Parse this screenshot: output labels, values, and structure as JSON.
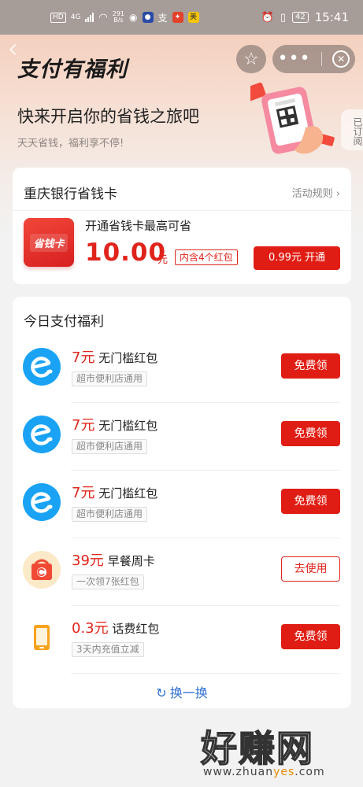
{
  "status_bar": {
    "net_chip": "HD",
    "net_type": "4G",
    "speed_value": "291",
    "speed_unit": "B/s",
    "battery": "42",
    "time": "15:41"
  },
  "header": {
    "title": "支付有福利",
    "star_icon": "star-icon",
    "more_icon": "more-icon",
    "close_icon": "close-circle-icon"
  },
  "hero": {
    "headline": "快来开启你的省钱之旅吧",
    "subline": "天天省钱，福利享不停!",
    "subscribed_tab": "已订阅"
  },
  "bank_card": {
    "title": "重庆银行省钱卡",
    "rules_link": "活动规则 ›",
    "icon_text": "省钱卡",
    "promo_line": "开通省钱卡最高可省",
    "amount": "10.00",
    "unit": "元",
    "badge": "内含4个红包",
    "button": "0.99元 开通"
  },
  "today": {
    "title": "今日支付福利",
    "items": [
      {
        "amount": "7元",
        "name": "无门槛红包",
        "tag": "超市便利店通用",
        "button": "免费领",
        "icon": "eleme-icon"
      },
      {
        "amount": "7元",
        "name": "无门槛红包",
        "tag": "超市便利店通用",
        "button": "免费领",
        "icon": "eleme-icon"
      },
      {
        "amount": "7元",
        "name": "无门槛红包",
        "tag": "超市便利店通用",
        "button": "免费领",
        "icon": "eleme-icon"
      },
      {
        "amount": "39元",
        "name": "早餐周卡",
        "tag": "一次领7张红包",
        "button": "去使用",
        "icon": "breakfast-bag-icon"
      },
      {
        "amount": "0.3元",
        "name": "话费红包",
        "tag": "3天内充值立减",
        "button": "免费领",
        "icon": "phone-icon"
      }
    ],
    "refresh": "换一换"
  },
  "watermark": {
    "brand": "好赚网",
    "url_prefix": "www.zhuan",
    "url_highlight": "yes",
    "url_suffix": ".com"
  },
  "colors": {
    "accent_red": "#e01d14",
    "link_blue": "#2f6fd1",
    "eleme_blue": "#1aa3f5"
  }
}
